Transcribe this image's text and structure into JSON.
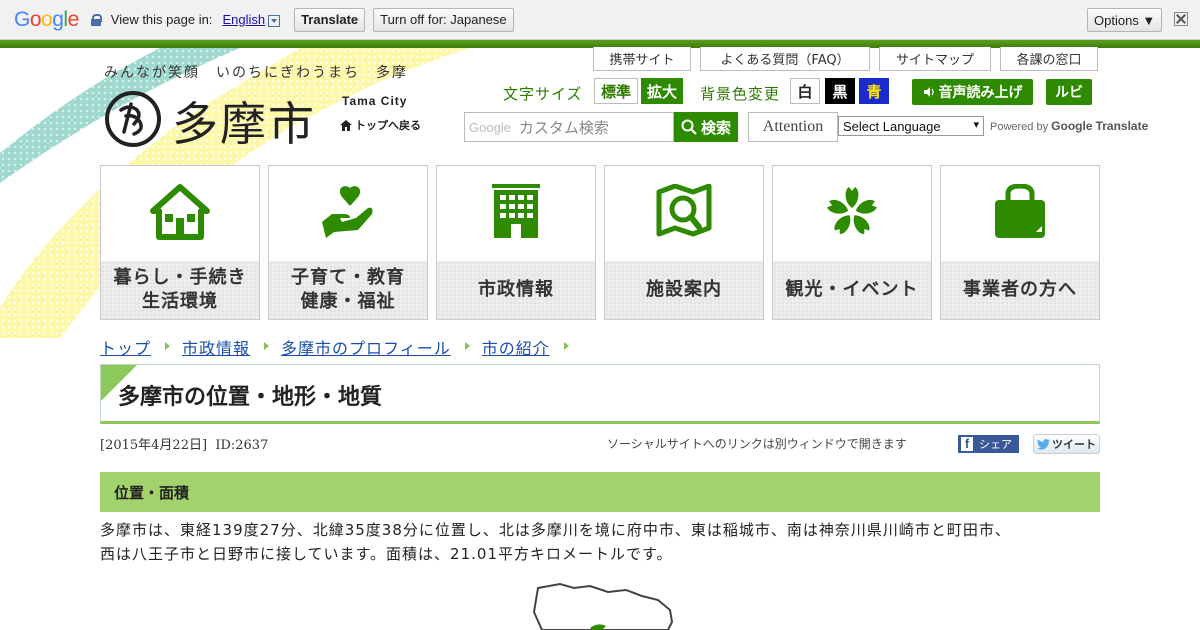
{
  "translate_bar": {
    "logo": "Google",
    "prompt": "View this page in:",
    "language": "English",
    "translate_label": "Translate",
    "turn_off_label": "Turn off for: Japanese",
    "options_label": "Options ▼"
  },
  "header": {
    "tagline": "みんなが笑顔　いのちにぎわうまち　多摩",
    "logo_text": "多摩市",
    "logo_en": "Tama City",
    "home_link": "トップへ戻る",
    "top_links": [
      "携帯サイト",
      "よくある質問（FAQ）",
      "サイトマップ",
      "各課の窓口"
    ],
    "font_size_label": "文字サイズ",
    "font_standard": "標準",
    "font_large": "拡大",
    "bg_label": "背景色変更",
    "bg_white": "白",
    "bg_black": "黒",
    "bg_blue": "青",
    "voice_label": "音声読み上げ",
    "ruby_label": "ルビ",
    "search_brand": "Google",
    "search_placeholder": "カスタム検索",
    "search_button": "検索",
    "attention_label": "Attention",
    "language_select": "Select Language",
    "powered_by": "Powered by",
    "powered_brand": "Google",
    "powered_translate": "Translate"
  },
  "tiles": [
    {
      "line1": "暮らし・手続き",
      "line2": "生活環境",
      "icon": "house-icon"
    },
    {
      "line1": "子育て・教育",
      "line2": "健康・福祉",
      "icon": "heart-hand-icon"
    },
    {
      "line1": "市政情報",
      "line2": "",
      "icon": "building-icon"
    },
    {
      "line1": "施設案内",
      "line2": "",
      "icon": "map-search-icon"
    },
    {
      "line1": "観光・イベント",
      "line2": "",
      "icon": "flower-icon"
    },
    {
      "line1": "事業者の方へ",
      "line2": "",
      "icon": "bag-icon"
    }
  ],
  "breadcrumb": [
    "トップ",
    "市政情報",
    "多摩市のプロフィール",
    "市の紹介"
  ],
  "page": {
    "title": "多摩市の位置・地形・地質",
    "date": "[2015年4月22日]",
    "id": "ID:2637",
    "social_note": "ソーシャルサイトへのリンクは別ウィンドウで開きます",
    "share_label": "シェア",
    "tweet_label": "ツイート",
    "section_title": "位置・面積",
    "body_line1": "多摩市は、東経139度27分、北緯35度38分に位置し、北は多摩川を境に府中市、東は稲城市、南は神奈川県川崎市と町田市、",
    "body_line2": "西は八王子市と日野市に接しています。面積は、21.01平方キロメートルです。"
  },
  "colors": {
    "brand_green": "#2e8b00",
    "section_green": "#a2d26c",
    "link_blue": "#1a4ea8"
  }
}
